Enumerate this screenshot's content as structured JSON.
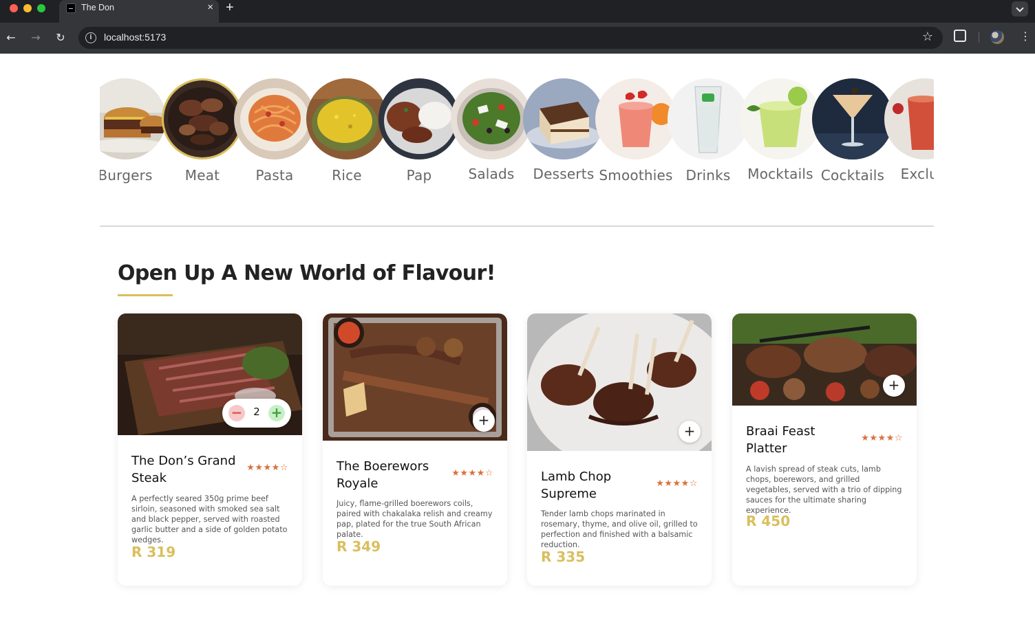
{
  "browser": {
    "tab_title": "The Don",
    "tab_close": "×",
    "new_tab": "+",
    "url": "localhost:5173",
    "back": "←",
    "forward": "→",
    "reload": "↻",
    "info": "i",
    "bookmark": "☆",
    "menu": "⋮"
  },
  "categories": [
    {
      "label": "Burgers",
      "selected": false
    },
    {
      "label": "Meat",
      "selected": true
    },
    {
      "label": "Pasta",
      "selected": false
    },
    {
      "label": "Rice",
      "selected": false
    },
    {
      "label": "Pap",
      "selected": false
    },
    {
      "label": "Salads",
      "selected": false
    },
    {
      "label": "Desserts",
      "selected": false
    },
    {
      "label": "Smoothies",
      "selected": false
    },
    {
      "label": "Drinks",
      "selected": false
    },
    {
      "label": "Mocktails",
      "selected": false
    },
    {
      "label": "Cocktails",
      "selected": false
    },
    {
      "label": "Exclusi",
      "selected": false
    }
  ],
  "section": {
    "title": "Open Up A New World of Flavour!"
  },
  "products": [
    {
      "name": "The Don’s Grand Steak",
      "rating": 4,
      "stars": "★★★★☆",
      "description": "A perfectly seared 350g prime beef sirloin, seasoned with smoked sea salt and black pepper, served with roasted garlic butter and a side of golden potato wedges.",
      "price": "R 319",
      "quantity": "2",
      "minus": "−",
      "plus": "+"
    },
    {
      "name": "The Boerewors Royale",
      "rating": 4,
      "stars": "★★★★☆",
      "description": "Juicy, flame-grilled boerewors coils, paired with chakalaka relish and creamy pap, plated for the true South African palate.",
      "price": "R 349",
      "add": "+"
    },
    {
      "name": "Lamb Chop Supreme",
      "rating": 4,
      "stars": "★★★★☆",
      "description": "Tender lamb chops marinated in rosemary, thyme, and olive oil, grilled to perfection and finished with a balsamic reduction.",
      "price": "R 335",
      "add": "+"
    },
    {
      "name": "Braai Feast Platter",
      "rating": 4,
      "stars": "★★★★☆",
      "description": "A lavish spread of steak cuts, lamb chops, boerewors, and grilled vegetables, served with a trio of dipping sauces for the ultimate sharing experience.",
      "price": "R 450",
      "add": "+"
    }
  ],
  "colors": {
    "accent_gold": "#d9bf5c",
    "star_orange": "#d9713d",
    "chrome_dark": "#202124",
    "chrome_mid": "#35363a"
  }
}
